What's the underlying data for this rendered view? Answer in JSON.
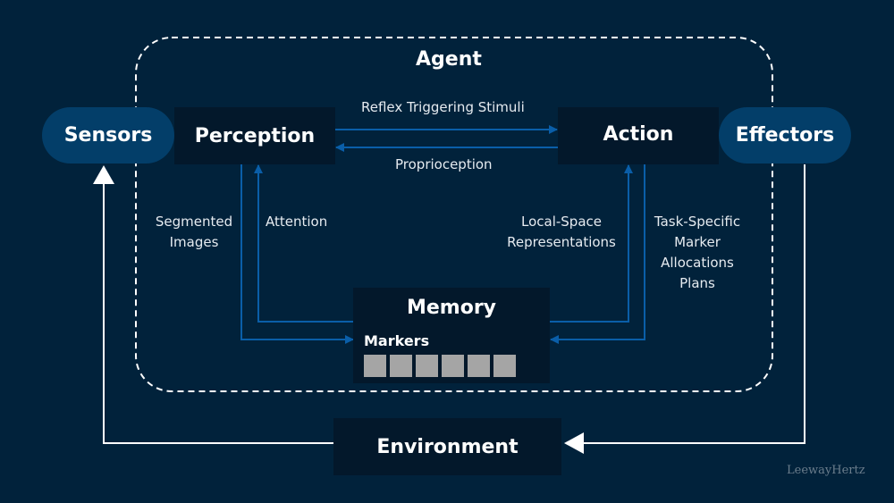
{
  "diagram": {
    "agent_title": "Agent",
    "nodes": {
      "sensors": "Sensors",
      "perception": "Perception",
      "action": "Action",
      "effectors": "Effectors",
      "memory": "Memory",
      "environment": "Environment"
    },
    "memory_markers": {
      "label": "Markers",
      "count": 6
    },
    "edge_labels": {
      "reflex": "Reflex Triggering Stimuli",
      "proprioception": "Proprioception",
      "segmented_images": [
        "Segmented",
        "Images"
      ],
      "attention": "Attention",
      "local_space": [
        "Local-Space",
        "Representations"
      ],
      "task_specific": [
        "Task-Specific",
        "Marker",
        "Allocations",
        "Plans"
      ]
    },
    "edges": [
      {
        "from": "perception",
        "to": "action",
        "label": "Reflex Triggering Stimuli"
      },
      {
        "from": "action",
        "to": "perception",
        "label": "Proprioception"
      },
      {
        "from": "perception",
        "to": "memory",
        "label": "Segmented Images"
      },
      {
        "from": "memory",
        "to": "perception",
        "label": "Attention"
      },
      {
        "from": "memory",
        "to": "action",
        "label": "Local-Space Representations"
      },
      {
        "from": "action",
        "to": "memory",
        "label": "Task-Specific Marker Allocations Plans"
      },
      {
        "from": "effectors",
        "to": "environment"
      },
      {
        "from": "environment",
        "to": "sensors"
      }
    ],
    "colors": {
      "background": "#01223b",
      "box": "#03182b",
      "pill": "#033e69",
      "internal_arrow": "#0a5ea8",
      "external_arrow": "#ffffff",
      "marker": "#a5a5a5"
    }
  },
  "watermark": "LeewayHertz"
}
